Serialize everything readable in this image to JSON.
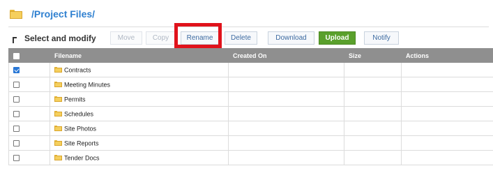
{
  "header": {
    "path": "/Project Files/",
    "icon": "folder-icon"
  },
  "toolbar": {
    "select_label": "Select and modify",
    "buttons": {
      "move": "Move",
      "copy": "Copy",
      "rename": "Rename",
      "delete": "Delete",
      "download": "Download",
      "upload": "Upload",
      "notify": "Notify"
    }
  },
  "table": {
    "columns": [
      "Filename",
      "Created On",
      "Size",
      "Actions"
    ],
    "rows": [
      {
        "name": "Contracts",
        "checked": true
      },
      {
        "name": "Meeting Minutes",
        "checked": false
      },
      {
        "name": "Permits",
        "checked": false
      },
      {
        "name": "Schedules",
        "checked": false
      },
      {
        "name": "Site Photos",
        "checked": false
      },
      {
        "name": "Site Reports",
        "checked": false
      },
      {
        "name": "Tender Docs",
        "checked": false
      }
    ]
  },
  "colors": {
    "accent": "#2f80d0",
    "upload": "#5aa02c",
    "highlight": "#e0121b",
    "header_bg": "#8f8f8f"
  }
}
